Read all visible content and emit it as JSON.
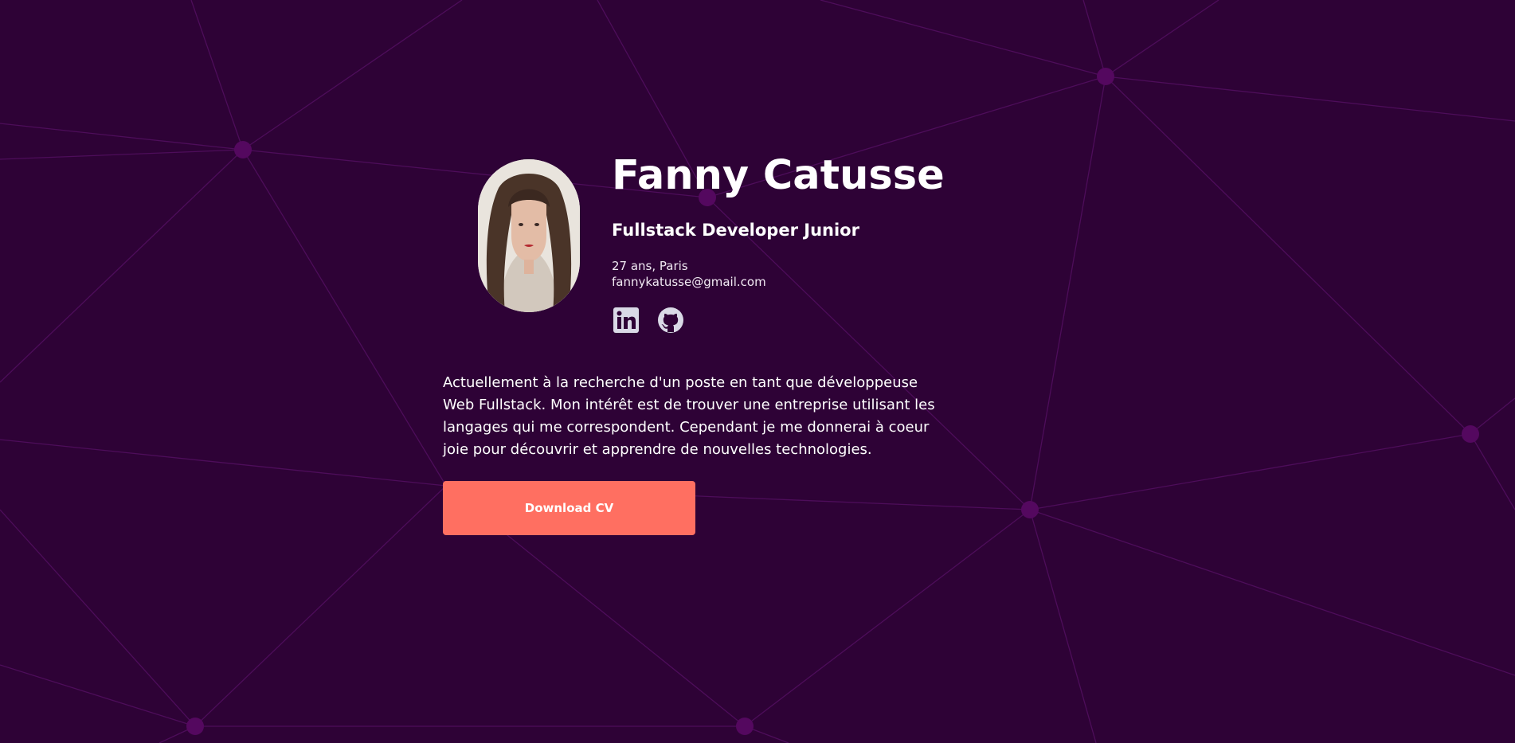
{
  "profile": {
    "name": "Fanny Catusse",
    "role": "Fullstack Developer Junior",
    "age_city": "27 ans, Paris",
    "email": "fannykatusse@gmail.com",
    "photo_alt": "Fanny Catusse"
  },
  "socials": [
    {
      "network": "LinkedIn",
      "icon": "linkedin-icon"
    },
    {
      "network": "GitHub",
      "icon": "github-icon"
    }
  ],
  "bio": "Actuellement à la recherche d'un poste en tant que développeuse Web Fullstack. Mon intérêt est de trouver une entreprise utilisant les langages qui me correspondent. Cependant je me donnerai à coeur joie pour découvrir et apprendre de nouvelles technologies.",
  "cv_button": {
    "label": "Download CV"
  },
  "colors": {
    "background": "#2e0236",
    "network_lines": "#4d0d5a",
    "network_nodes": "#54085f",
    "accent_button": "#ff6f61",
    "text": "#ffffff",
    "social_icons": "#d9d9e6"
  }
}
